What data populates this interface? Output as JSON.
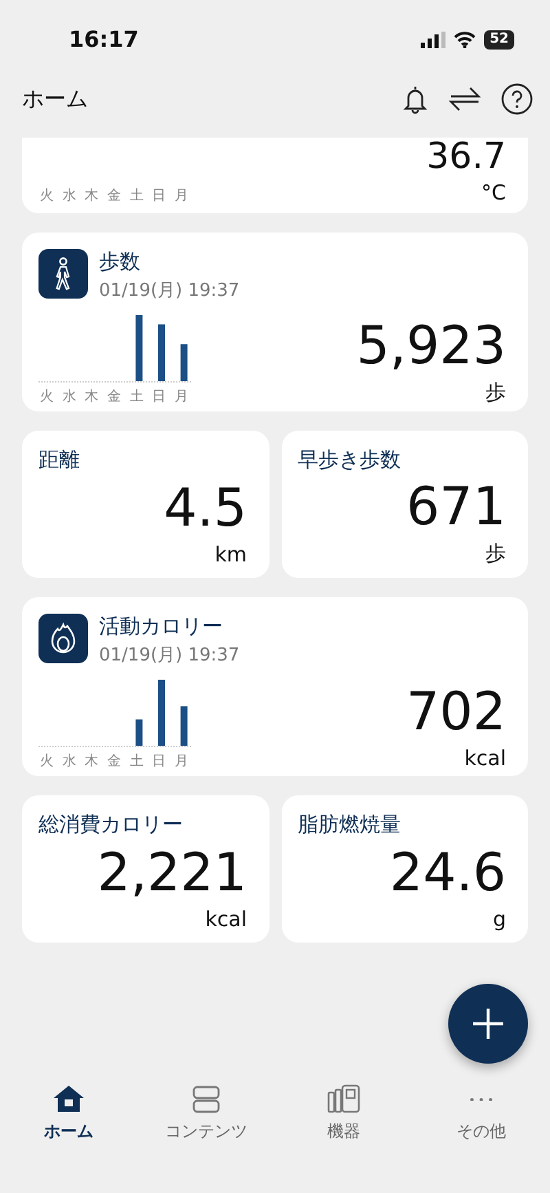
{
  "status_bar": {
    "time": "16:17",
    "battery": "52"
  },
  "header": {
    "title": "ホーム"
  },
  "cards": [
    {
      "kind": "partial",
      "value": "36.7",
      "unit": "°C",
      "days": [
        "火",
        "水",
        "木",
        "金",
        "土",
        "日",
        "月"
      ]
    },
    {
      "kind": "chart",
      "title": "歩数",
      "date": "01/19(月) 19:37",
      "value": "5,923",
      "unit": "歩",
      "days": [
        "火",
        "水",
        "木",
        "金",
        "土",
        "日",
        "月"
      ]
    },
    {
      "kind": "pair",
      "items": [
        {
          "title": "距離",
          "value": "4.5",
          "unit": "km"
        },
        {
          "title": "早歩き歩数",
          "value": "671",
          "unit": "歩"
        }
      ]
    },
    {
      "kind": "chart",
      "title": "活動カロリー",
      "date": "01/19(月) 19:37",
      "value": "702",
      "unit": "kcal",
      "days": [
        "火",
        "水",
        "木",
        "金",
        "土",
        "日",
        "月"
      ]
    },
    {
      "kind": "pair",
      "items": [
        {
          "title": "総消費カロリー",
          "value": "2,221",
          "unit": "kcal"
        },
        {
          "title": "脂肪燃焼量",
          "value": "24.6",
          "unit": "g"
        }
      ]
    }
  ],
  "tabs": [
    {
      "label": "ホーム",
      "selected": true
    },
    {
      "label": "コンテンツ",
      "selected": false
    },
    {
      "label": "機器",
      "selected": false
    },
    {
      "label": "その他",
      "selected": false
    }
  ]
}
